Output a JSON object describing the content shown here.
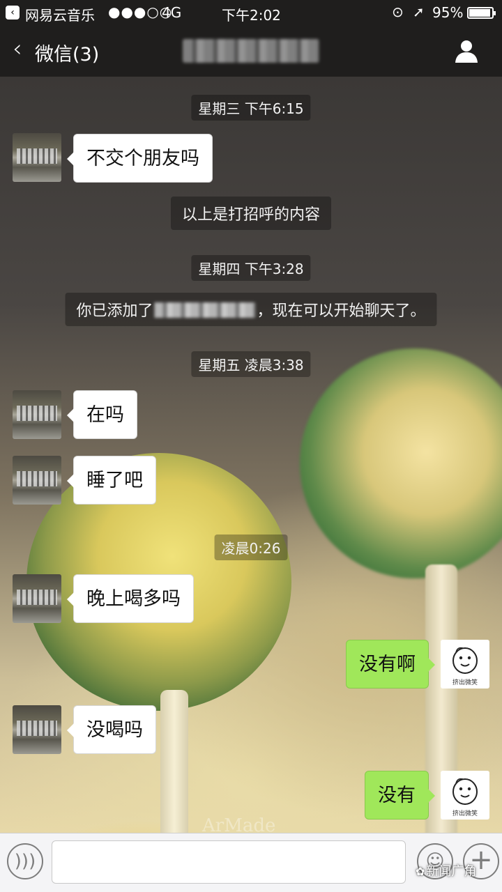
{
  "status_bar": {
    "app_name": "网易云音乐",
    "signal": "●●●○○",
    "network": "4G",
    "time": "下午2:02",
    "battery_pct": "95%",
    "battery_level": 0.95
  },
  "nav": {
    "back_label": "微信(3)"
  },
  "messages": {
    "t1": "星期三 下午6:15",
    "m1": "不交个朋友吗",
    "sys1": "以上是打招呼的内容",
    "t2": "星期四 下午3:28",
    "sys2_pre": "你已添加了",
    "sys2_post": "，现在可以开始聊天了。",
    "t3": "星期五 凌晨3:38",
    "m2": "在吗",
    "m3": "睡了吧",
    "t4": "凌晨0:26",
    "m4": "晚上喝多吗",
    "m5": "没有啊",
    "m6": "没喝吗",
    "m7": "没有"
  },
  "my_avatar_caption": "挤出微笑",
  "watermark": {
    "text": "新闻广角",
    "background_text": "ArMade"
  }
}
